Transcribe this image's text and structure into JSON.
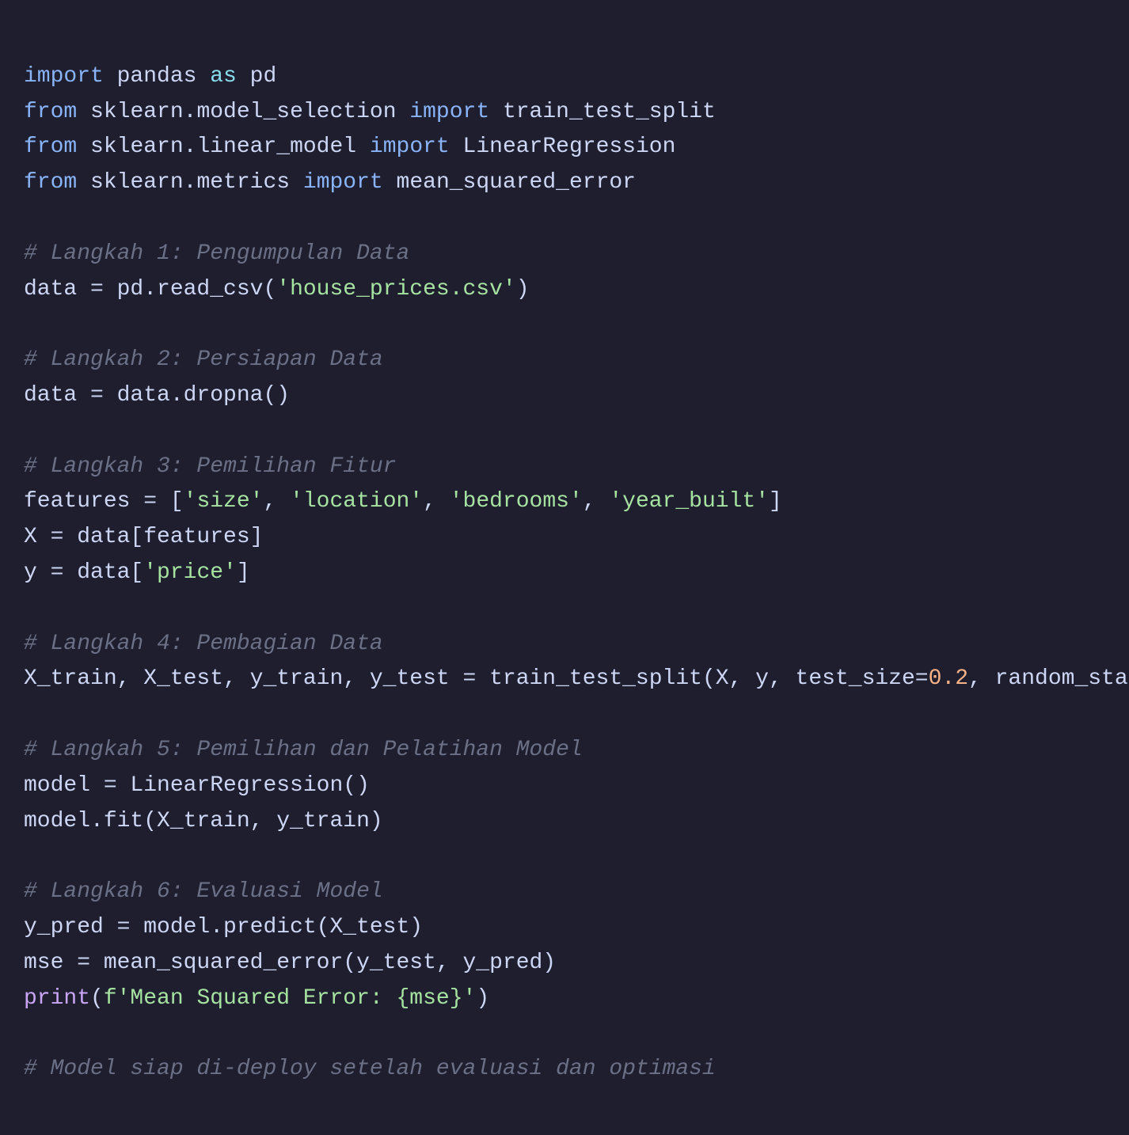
{
  "code": {
    "lines": [
      {
        "type": "import_line_1",
        "text": "import pandas as pd"
      },
      {
        "type": "import_line_2",
        "text": "from sklearn.model_selection import train_test_split"
      },
      {
        "type": "import_line_3",
        "text": "from sklearn.linear_model import LinearRegression"
      },
      {
        "type": "import_line_4",
        "text": "from sklearn.metrics import mean_squared_error"
      },
      {
        "type": "blank"
      },
      {
        "type": "comment_1",
        "text": "# Langkah 1: Pengumpulan Data"
      },
      {
        "type": "code_1",
        "text": "data = pd.read_csv('house_prices.csv')"
      },
      {
        "type": "blank"
      },
      {
        "type": "comment_2",
        "text": "# Langkah 2: Persiapan Data"
      },
      {
        "type": "code_2",
        "text": "data = data.dropna()"
      },
      {
        "type": "blank"
      },
      {
        "type": "comment_3",
        "text": "# Langkah 3: Pemilihan Fitur"
      },
      {
        "type": "code_3a",
        "text": "features = ['size', 'location', 'bedrooms', 'year_built']"
      },
      {
        "type": "code_3b",
        "text": "X = data[features]"
      },
      {
        "type": "code_3c",
        "text": "y = data['price']"
      },
      {
        "type": "blank"
      },
      {
        "type": "comment_4",
        "text": "# Langkah 4: Pembagian Data"
      },
      {
        "type": "code_4",
        "text": "X_train, X_test, y_train, y_test = train_test_split(X, y, test_size=0.2, random_sta"
      },
      {
        "type": "blank"
      },
      {
        "type": "comment_5",
        "text": "# Langkah 5: Pemilihan dan Pelatihan Model"
      },
      {
        "type": "code_5a",
        "text": "model = LinearRegression()"
      },
      {
        "type": "code_5b",
        "text": "model.fit(X_train, y_train)"
      },
      {
        "type": "blank"
      },
      {
        "type": "comment_6",
        "text": "# Langkah 6: Evaluasi Model"
      },
      {
        "type": "code_6a",
        "text": "y_pred = model.predict(X_test)"
      },
      {
        "type": "code_6b",
        "text": "mse = mean_squared_error(y_test, y_pred)"
      },
      {
        "type": "code_6c",
        "text": "print(f'Mean Squared Error: {mse}')"
      },
      {
        "type": "blank"
      },
      {
        "type": "comment_7",
        "text": "# Model siap di-deploy setelah evaluasi dan optimasi"
      }
    ]
  }
}
